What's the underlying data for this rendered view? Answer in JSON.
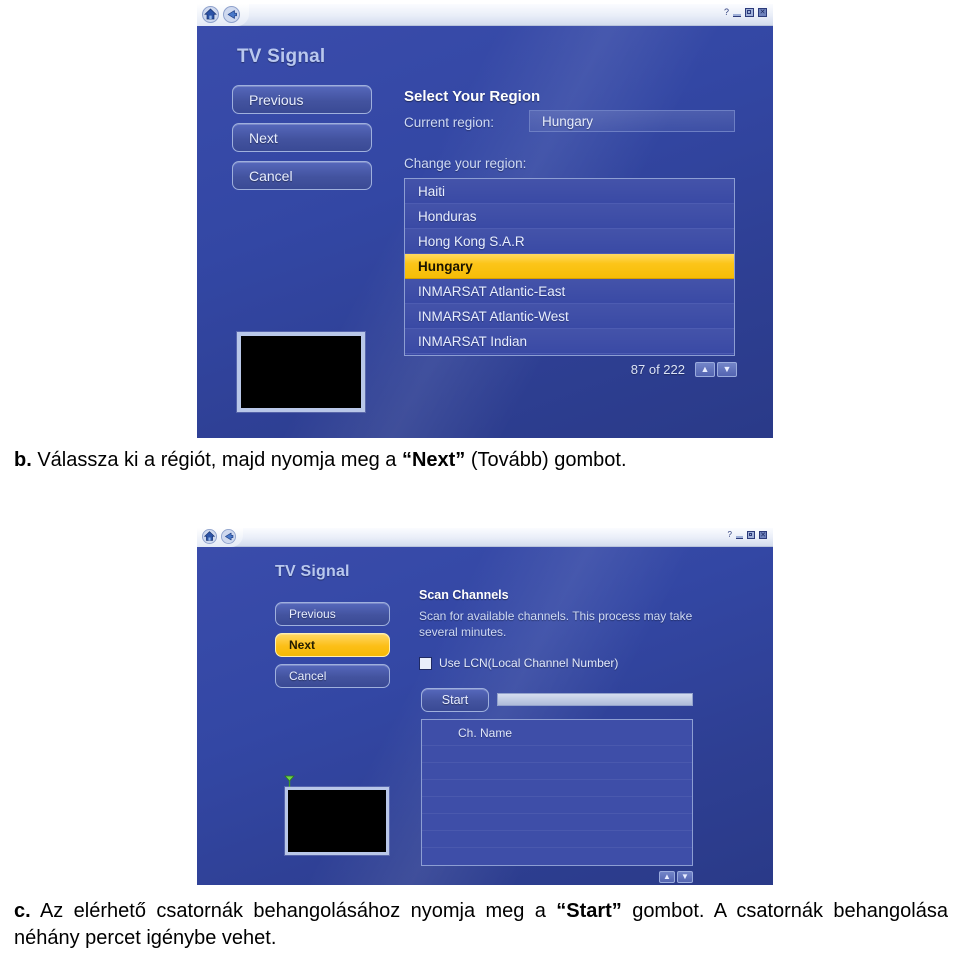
{
  "page": {
    "background": "#ffffff",
    "accent_yellow": "#fcc519",
    "window_blue": "#33449c"
  },
  "window1": {
    "titlebar": {
      "home_icon": "home-icon",
      "back_icon": "back-arrow-icon",
      "help_icon": "help-icon",
      "minimize_icon": "minimize-icon",
      "maximize_icon": "maximize-icon",
      "close_icon": "close-icon"
    },
    "app_title": "TV Signal",
    "buttons": [
      {
        "label": "Previous",
        "state": "normal"
      },
      {
        "label": "Next",
        "state": "normal"
      },
      {
        "label": "Cancel",
        "state": "normal"
      }
    ],
    "section_title": "Select Your Region",
    "current_region_label": "Current region:",
    "current_region_value": "Hungary",
    "change_region_label": "Change your region:",
    "region_list": [
      {
        "name": "Haiti",
        "selected": false
      },
      {
        "name": "Honduras",
        "selected": false
      },
      {
        "name": "Hong Kong S.A.R",
        "selected": false
      },
      {
        "name": "Hungary",
        "selected": true
      },
      {
        "name": "INMARSAT Atlantic-East",
        "selected": false
      },
      {
        "name": "INMARSAT Atlantic-West",
        "selected": false
      },
      {
        "name": "INMARSAT Indian",
        "selected": false
      }
    ],
    "list_counter": "87 of 222",
    "scroll_up_icon": "chevron-up-icon",
    "scroll_down_icon": "chevron-down-icon",
    "preview": "video-preview-black"
  },
  "caption_b": {
    "marker": "b.",
    "text_before": " Válassza ki a régiót, majd nyomja meg a ",
    "emphasis": "“Next”",
    "text_after": " (Tovább) gombot."
  },
  "window2": {
    "titlebar": {
      "home_icon": "home-icon",
      "back_icon": "back-arrow-icon",
      "help_icon": "help-icon",
      "minimize_icon": "minimize-icon",
      "maximize_icon": "maximize-icon",
      "close_icon": "close-icon"
    },
    "app_title": "TV Signal",
    "buttons": [
      {
        "label": "Previous",
        "state": "normal"
      },
      {
        "label": "Next",
        "state": "active"
      },
      {
        "label": "Cancel",
        "state": "normal"
      }
    ],
    "section_title": "Scan Channels",
    "section_desc": "Scan for available channels. This process may take several minutes.",
    "checkbox_label": "Use LCN(Local Channel Number)",
    "checkbox_checked": false,
    "start_button": "Start",
    "progress_percent": 0,
    "table_header": "Ch. Name",
    "table_rows": [
      "",
      "",
      "",
      "",
      "",
      "",
      ""
    ],
    "scroll_up_icon": "chevron-up-icon",
    "scroll_down_icon": "chevron-down-icon",
    "antenna_icon": "antenna-signal-icon",
    "preview": "video-preview-black"
  },
  "caption_c": {
    "marker": "c.",
    "text_before": " Az elérhető csatornák behangolásához nyomja meg a ",
    "emphasis": "“Start”",
    "text_after": " gombot. A csatornák behangolása néhány percet igénybe vehet."
  }
}
